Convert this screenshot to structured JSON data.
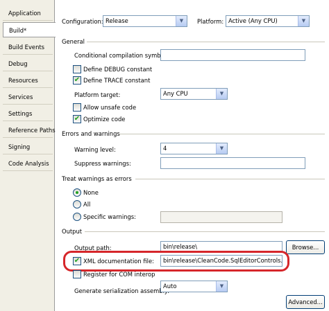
{
  "sidebar": {
    "tabs": [
      {
        "label": "Application"
      },
      {
        "label": "Build*"
      },
      {
        "label": "Build Events"
      },
      {
        "label": "Debug"
      },
      {
        "label": "Resources"
      },
      {
        "label": "Services"
      },
      {
        "label": "Settings"
      },
      {
        "label": "Reference Paths"
      },
      {
        "label": "Signing"
      },
      {
        "label": "Code Analysis"
      }
    ],
    "active_tab": "Build*"
  },
  "header": {
    "configuration_label": "Configuration:",
    "configuration_value": "Release",
    "platform_label": "Platform:",
    "platform_value": "Active (Any CPU)"
  },
  "general": {
    "title": "General",
    "conditional_label": "Conditional compilation symbols:",
    "conditional_value": "",
    "define_debug": {
      "label": "Define DEBUG constant",
      "checked": false
    },
    "define_trace": {
      "label": "Define TRACE constant",
      "checked": true
    },
    "platform_target_label": "Platform target:",
    "platform_target_value": "Any CPU",
    "allow_unsafe": {
      "label": "Allow unsafe code",
      "checked": false
    },
    "optimize": {
      "label": "Optimize code",
      "checked": true
    }
  },
  "errors": {
    "title": "Errors and warnings",
    "warning_level_label": "Warning level:",
    "warning_level_value": "4",
    "suppress_label": "Suppress warnings:",
    "suppress_value": ""
  },
  "treat": {
    "title": "Treat warnings as errors",
    "options": [
      {
        "label": "None",
        "selected": true
      },
      {
        "label": "All",
        "selected": false
      },
      {
        "label": "Specific warnings:",
        "selected": false
      }
    ],
    "specific_value": ""
  },
  "output": {
    "title": "Output",
    "output_path_label": "Output path:",
    "output_path_value": "bin\\release\\",
    "browse_label": "Browse...",
    "xml_doc": {
      "label": "XML documentation file:",
      "checked": true
    },
    "xml_doc_value": "bin\\release\\CleanCode.SqlEditorControls.XML",
    "register_com": {
      "label": "Register for COM interop",
      "checked": false
    },
    "serialization_label": "Generate serialization assembly:",
    "serialization_value": "Auto",
    "advanced_label": "Advanced..."
  },
  "icons": {
    "check": "✔",
    "dropdown": "▼"
  },
  "colors": {
    "highlight": "#d6262a",
    "check": "#21a121",
    "sidebar": "#f1efe5"
  }
}
